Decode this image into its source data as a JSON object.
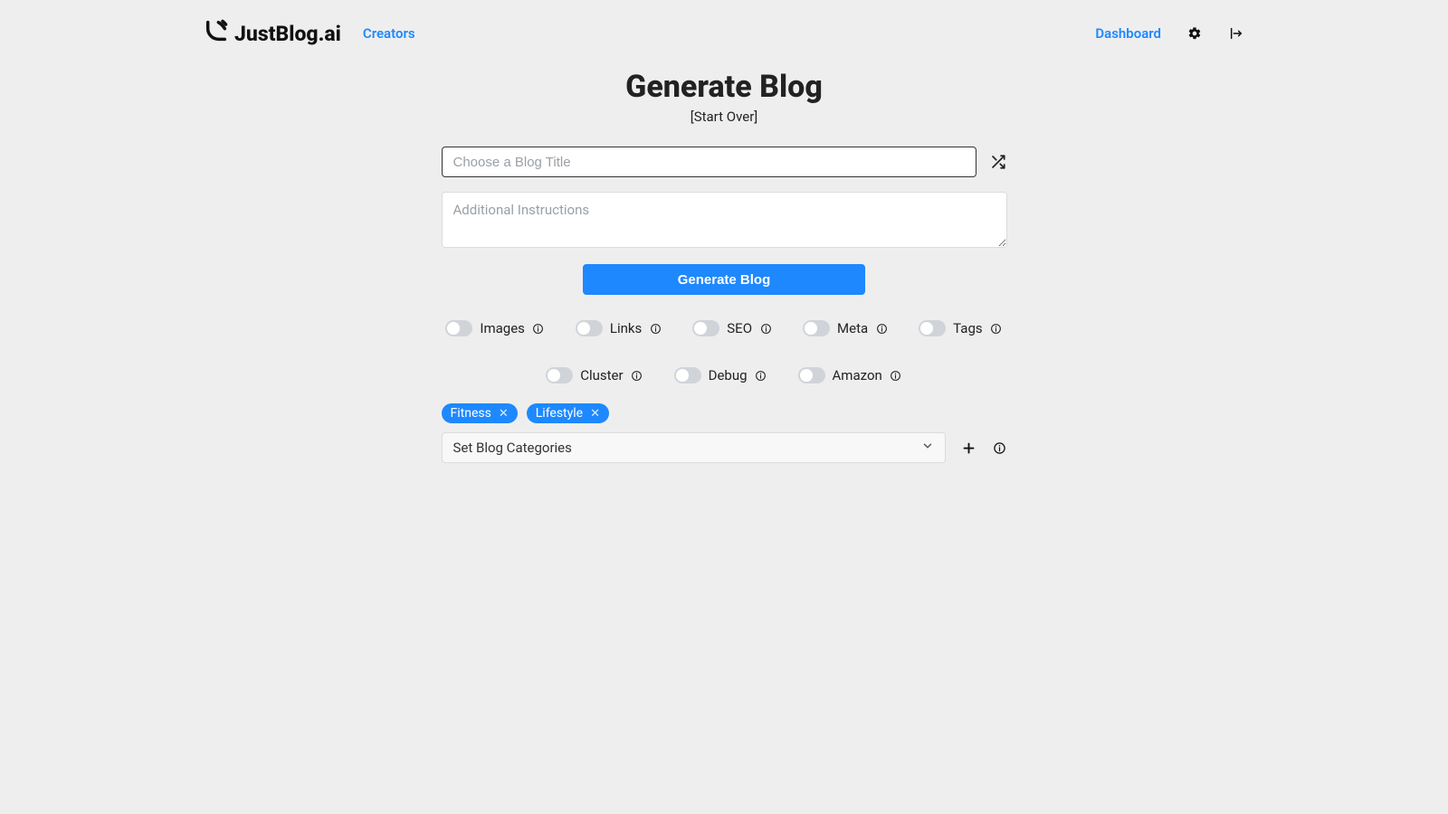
{
  "nav": {
    "brand": "JustBlog.ai",
    "creators": "Creators",
    "dashboard": "Dashboard"
  },
  "main": {
    "title": "Generate Blog",
    "start_over": "[Start Over]",
    "title_placeholder": "Choose a Blog Title",
    "instructions_placeholder": "Additional Instructions",
    "generate_label": "Generate Blog"
  },
  "switches_row1": [
    {
      "label": "Images"
    },
    {
      "label": "Links"
    },
    {
      "label": "SEO"
    },
    {
      "label": "Meta"
    },
    {
      "label": "Tags"
    }
  ],
  "switches_row2": [
    {
      "label": "Cluster"
    },
    {
      "label": "Debug"
    },
    {
      "label": "Amazon"
    }
  ],
  "tags": [
    "Fitness",
    "Lifestyle"
  ],
  "categories": {
    "placeholder": "Set Blog Categories"
  }
}
